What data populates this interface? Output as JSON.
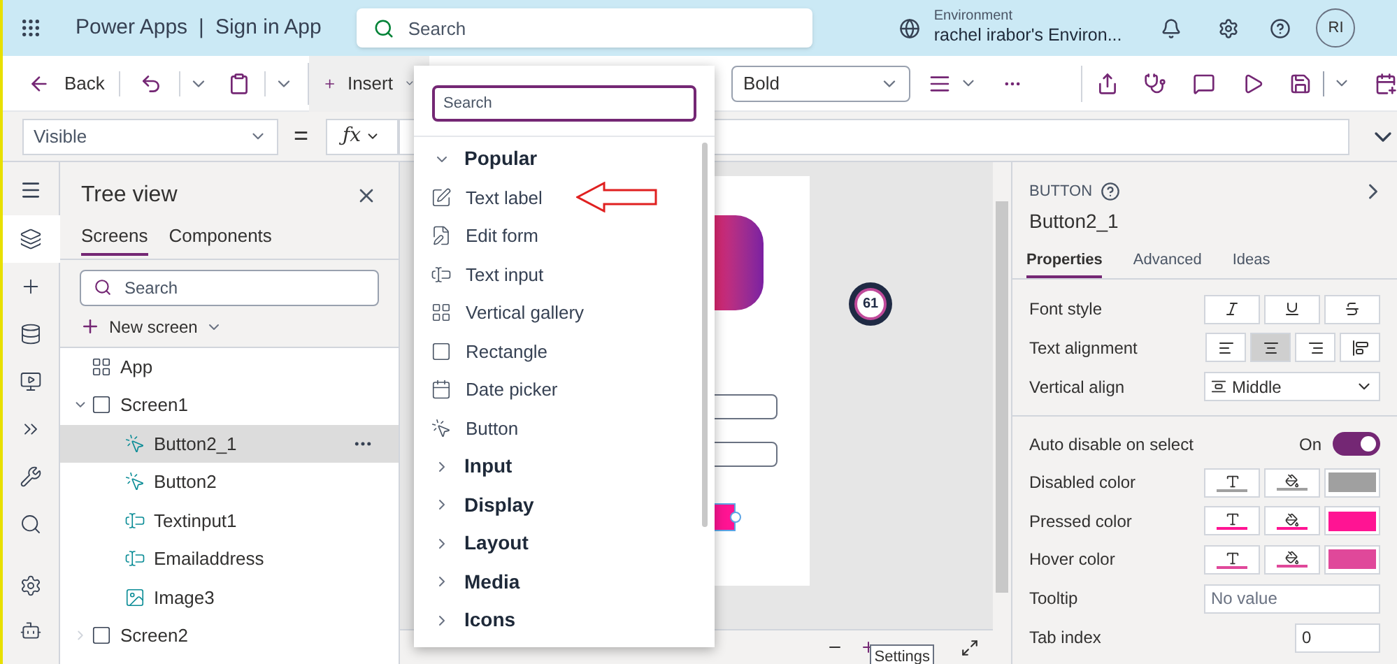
{
  "header": {
    "app_name": "Power Apps",
    "separator": "|",
    "app_title": "Sign in App",
    "search": {
      "placeholder": "Search"
    },
    "environment_label": "Environment",
    "environment_name": "rachel irabor's Environ...",
    "avatar": "RI"
  },
  "toolbar": {
    "back": "Back",
    "insert": "Insert",
    "font_weight": "Bold"
  },
  "formula_bar": {
    "property": "Visible",
    "equals": "=",
    "function": "ƒx"
  },
  "sidebar": {
    "items": [
      {
        "kind": "layers",
        "selected": true
      },
      {
        "kind": "plus",
        "selected": false
      },
      {
        "kind": "data",
        "selected": false
      },
      {
        "kind": "media",
        "selected": false
      },
      {
        "kind": "automate",
        "selected": false
      },
      {
        "kind": "tools",
        "selected": false
      },
      {
        "kind": "search",
        "selected": false
      }
    ],
    "bottom": [
      {
        "kind": "settings"
      },
      {
        "kind": "bot"
      }
    ]
  },
  "tree_view": {
    "title": "Tree view",
    "tabs": [
      {
        "label": "Screens",
        "selected": true
      },
      {
        "label": "Components",
        "selected": false
      }
    ],
    "search": {
      "placeholder": "Search"
    },
    "new_screen": "New screen",
    "items": [
      {
        "kind": "app",
        "label": "App",
        "selected": false
      },
      {
        "kind": "screen",
        "label": "Screen1",
        "selected": false,
        "expanded": true,
        "children": [
          {
            "kind": "button",
            "label": "Button2_1",
            "selected": true
          },
          {
            "kind": "button",
            "label": "Button2",
            "selected": false
          },
          {
            "kind": "textinput",
            "label": "Textinput1",
            "selected": false
          },
          {
            "kind": "textinput",
            "label": "Emailaddress",
            "selected": false
          },
          {
            "kind": "image",
            "label": "Image3",
            "selected": false
          }
        ]
      },
      {
        "kind": "screen",
        "label": "Screen2",
        "selected": false,
        "expanded": false
      }
    ]
  },
  "insert_menu": {
    "search": {
      "placeholder": "Search"
    },
    "items": [
      {
        "kind": "category",
        "label": "Popular",
        "expanded": true
      },
      {
        "kind": "text_label",
        "label": "Text label",
        "annotated": true
      },
      {
        "kind": "edit_form",
        "label": "Edit form",
        "annotated": false
      },
      {
        "kind": "text_input",
        "label": "Text input",
        "annotated": false
      },
      {
        "kind": "gallery",
        "label": "Vertical gallery",
        "annotated": false
      },
      {
        "kind": "rectangle",
        "label": "Rectangle",
        "annotated": false
      },
      {
        "kind": "date_picker",
        "label": "Date picker",
        "annotated": false
      },
      {
        "kind": "button",
        "label": "Button",
        "annotated": false
      },
      {
        "kind": "category",
        "label": "Input",
        "expanded": false
      },
      {
        "kind": "category",
        "label": "Display",
        "expanded": false
      },
      {
        "kind": "category",
        "label": "Layout",
        "expanded": false
      },
      {
        "kind": "category",
        "label": "Media",
        "expanded": false
      },
      {
        "kind": "category",
        "label": "Icons",
        "expanded": false
      }
    ]
  },
  "canvas": {
    "badge": "61",
    "tooltip": "Settings"
  },
  "properties": {
    "type": "BUTTON",
    "name": "Button2_1",
    "tabs": [
      {
        "label": "Properties",
        "selected": true
      },
      {
        "label": "Advanced",
        "selected": false
      },
      {
        "label": "Ideas",
        "selected": false
      }
    ],
    "font_style_label": "Font style",
    "font_style": [
      {
        "kind": "italic",
        "selected": false
      },
      {
        "kind": "underline",
        "selected": false
      },
      {
        "kind": "strikethrough",
        "selected": false
      }
    ],
    "text_alignment_label": "Text alignment",
    "text_alignment": [
      {
        "kind": "left",
        "selected": false
      },
      {
        "kind": "center",
        "selected": true
      },
      {
        "kind": "right",
        "selected": false
      },
      {
        "kind": "justify",
        "selected": false
      }
    ],
    "vertical_align_label": "Vertical align",
    "vertical_align": "Middle",
    "auto_disable_label": "Auto disable on select",
    "auto_disable_state": "On",
    "auto_disable": true,
    "colors": [
      {
        "label": "Disabled color",
        "color": "#a0a0a0"
      },
      {
        "label": "Pressed color",
        "color": "#ff1493"
      },
      {
        "label": "Hover color",
        "color": "#e0489a"
      }
    ],
    "tooltip_label": "Tooltip",
    "tooltip": {
      "placeholder": "No value"
    },
    "tab_index_label": "Tab index",
    "tab_index": "0"
  }
}
